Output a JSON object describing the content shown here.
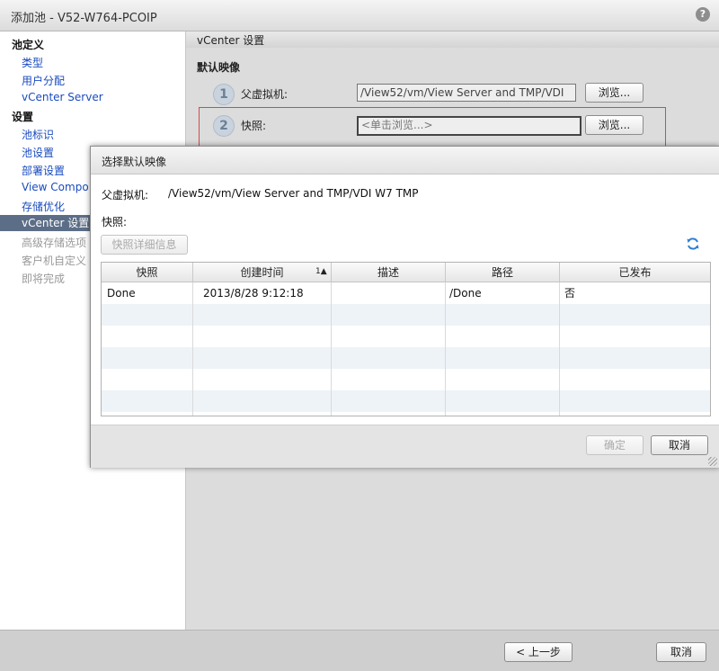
{
  "window": {
    "title": "添加池 - V52-W764-PCOIP",
    "help": "?"
  },
  "sidebar": {
    "section_pool_def": "池定义",
    "type": "类型",
    "user_assign": "用户分配",
    "vcenter_server": "vCenter Server",
    "section_settings": "设置",
    "pool_id": "池标识",
    "pool_settings": "池设置",
    "deploy_settings": "部署设置",
    "view_composer": "View Compo",
    "storage_opt": "存储优化",
    "vcenter_settings": "vCenter 设置",
    "adv_storage": "高级存储选项",
    "guest_custom": "客户机自定义",
    "finish": "即将完成"
  },
  "main": {
    "header": "vCenter 设置",
    "section": "默认映像",
    "step1": {
      "num": "1",
      "label": "父虚拟机:",
      "value": "/View52/vm/View Server and TMP/VDI",
      "browse": "浏览..."
    },
    "step2": {
      "num": "2",
      "label": "快照:",
      "placeholder": "<单击浏览...>",
      "browse": "浏览..."
    }
  },
  "footer": {
    "prev": "< 上一步",
    "cancel": "取消"
  },
  "dialog": {
    "title": "选择默认映像",
    "parent_label": "父虚拟机:",
    "parent_value": "/View52/vm/View Server and TMP/VDI W7 TMP",
    "snapshot_label": "快照:",
    "details_button": "快照详细信息",
    "columns": [
      "快照",
      "创建时间",
      "描述",
      "路径",
      "已发布"
    ],
    "sort_indicator": "1▲",
    "rows": [
      {
        "name": "Done",
        "created": "2013/8/28 9:12:18",
        "desc": "",
        "path": "/Done",
        "published": "否"
      }
    ],
    "ok": "确定",
    "cancel": "取消"
  }
}
